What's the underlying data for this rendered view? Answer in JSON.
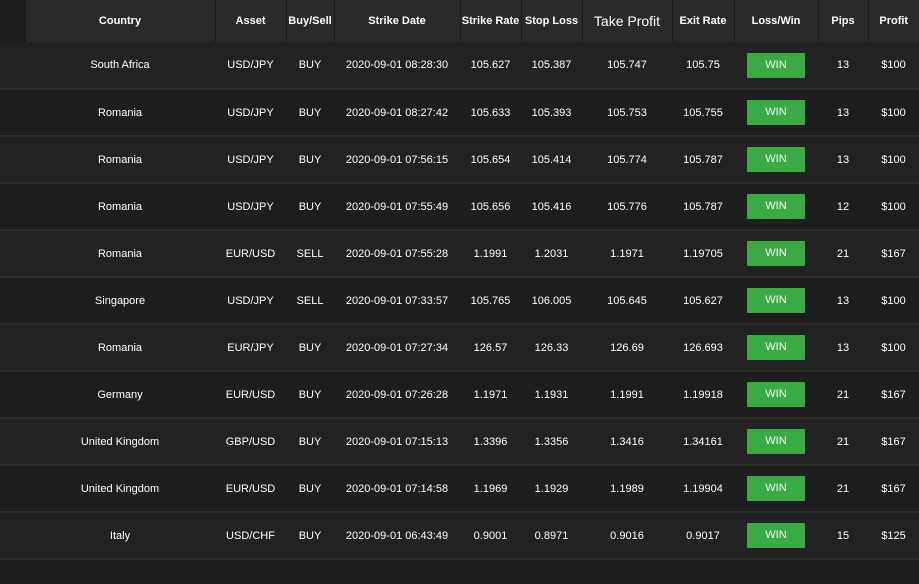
{
  "columns": [
    "Country",
    "Asset",
    "Buy/Sell",
    "Strike Date",
    "Strike Rate",
    "Stop Loss",
    "Take Profit",
    "Exit Rate",
    "Loss/Win",
    "Pips",
    "Profit"
  ],
  "rows": [
    {
      "country": "South Africa",
      "asset": "USD/JPY",
      "side": "BUY",
      "date": "2020-09-01 08:28:30",
      "strike": "105.627",
      "stop": "105.387",
      "take": "105.747",
      "exit": "105.75",
      "result": "WIN",
      "pips": "13",
      "profit": "$100"
    },
    {
      "country": "Romania",
      "asset": "USD/JPY",
      "side": "BUY",
      "date": "2020-09-01 08:27:42",
      "strike": "105.633",
      "stop": "105.393",
      "take": "105.753",
      "exit": "105.755",
      "result": "WIN",
      "pips": "13",
      "profit": "$100"
    },
    {
      "country": "Romania",
      "asset": "USD/JPY",
      "side": "BUY",
      "date": "2020-09-01 07:56:15",
      "strike": "105.654",
      "stop": "105.414",
      "take": "105.774",
      "exit": "105.787",
      "result": "WIN",
      "pips": "13",
      "profit": "$100"
    },
    {
      "country": "Romania",
      "asset": "USD/JPY",
      "side": "BUY",
      "date": "2020-09-01 07:55:49",
      "strike": "105.656",
      "stop": "105.416",
      "take": "105.776",
      "exit": "105.787",
      "result": "WIN",
      "pips": "12",
      "profit": "$100"
    },
    {
      "country": "Romania",
      "asset": "EUR/USD",
      "side": "SELL",
      "date": "2020-09-01 07:55:28",
      "strike": "1.1991",
      "stop": "1.2031",
      "take": "1.1971",
      "exit": "1.19705",
      "result": "WIN",
      "pips": "21",
      "profit": "$167"
    },
    {
      "country": "Singapore",
      "asset": "USD/JPY",
      "side": "SELL",
      "date": "2020-09-01 07:33:57",
      "strike": "105.765",
      "stop": "106.005",
      "take": "105.645",
      "exit": "105.627",
      "result": "WIN",
      "pips": "13",
      "profit": "$100"
    },
    {
      "country": "Romania",
      "asset": "EUR/JPY",
      "side": "BUY",
      "date": "2020-09-01 07:27:34",
      "strike": "126.57",
      "stop": "126.33",
      "take": "126.69",
      "exit": "126.693",
      "result": "WIN",
      "pips": "13",
      "profit": "$100"
    },
    {
      "country": "Germany",
      "asset": "EUR/USD",
      "side": "BUY",
      "date": "2020-09-01 07:26:28",
      "strike": "1.1971",
      "stop": "1.1931",
      "take": "1.1991",
      "exit": "1.19918",
      "result": "WIN",
      "pips": "21",
      "profit": "$167"
    },
    {
      "country": "United Kingdom",
      "asset": "GBP/USD",
      "side": "BUY",
      "date": "2020-09-01 07:15:13",
      "strike": "1.3396",
      "stop": "1.3356",
      "take": "1.3416",
      "exit": "1.34161",
      "result": "WIN",
      "pips": "21",
      "profit": "$167"
    },
    {
      "country": "United Kingdom",
      "asset": "EUR/USD",
      "side": "BUY",
      "date": "2020-09-01 07:14:58",
      "strike": "1.1969",
      "stop": "1.1929",
      "take": "1.1989",
      "exit": "1.19904",
      "result": "WIN",
      "pips": "21",
      "profit": "$167"
    },
    {
      "country": "Italy",
      "asset": "USD/CHF",
      "side": "BUY",
      "date": "2020-09-01 06:43:49",
      "strike": "0.9001",
      "stop": "0.8971",
      "take": "0.9016",
      "exit": "0.9017",
      "result": "WIN",
      "pips": "15",
      "profit": "$125"
    }
  ],
  "colors": {
    "win": "#3aaa45",
    "header_bg": "#2a2a2a",
    "row_bg": "#222222"
  }
}
